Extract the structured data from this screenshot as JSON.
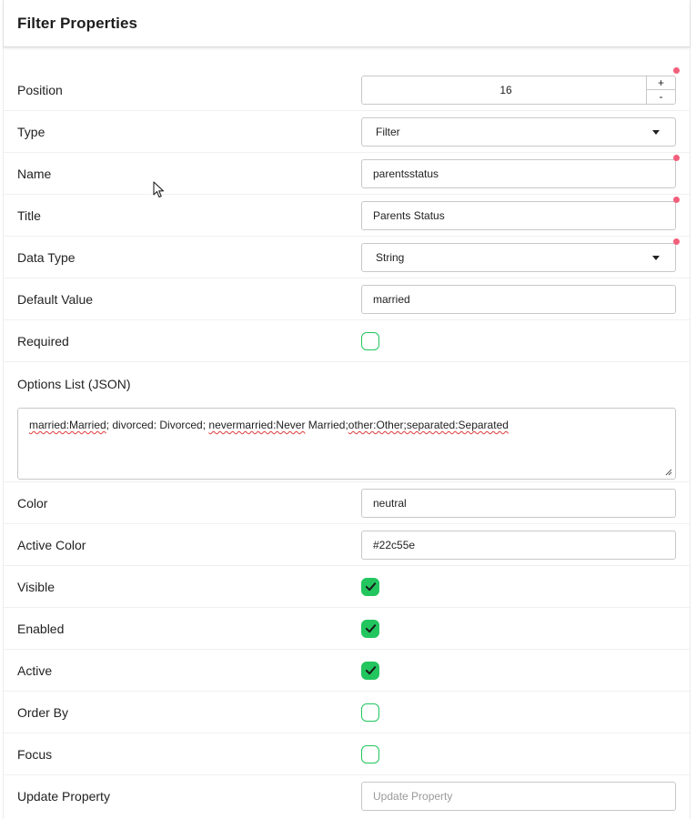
{
  "header": {
    "title": "Filter Properties"
  },
  "fields": {
    "position": {
      "label": "Position",
      "value": "16",
      "plus": "+",
      "minus": "-"
    },
    "type": {
      "label": "Type",
      "value": "Filter"
    },
    "name": {
      "label": "Name",
      "value": "parentsstatus"
    },
    "title": {
      "label": "Title",
      "value": "Parents Status"
    },
    "data_type": {
      "label": "Data Type",
      "value": "String"
    },
    "default_value": {
      "label": "Default Value",
      "value": "married"
    },
    "required": {
      "label": "Required",
      "checked": false
    },
    "options_list": {
      "label": "Options List (JSON)",
      "parts": [
        "married:Married",
        "; divorced: Divorced; ",
        "nevermarried:Never",
        " Married;",
        "other:Other;separated:Separated"
      ]
    },
    "color": {
      "label": "Color",
      "value": "neutral"
    },
    "active_color": {
      "label": "Active Color",
      "value": "#22c55e"
    },
    "visible": {
      "label": "Visible",
      "checked": true
    },
    "enabled": {
      "label": "Enabled",
      "checked": true
    },
    "active": {
      "label": "Active",
      "checked": true
    },
    "order_by": {
      "label": "Order By",
      "checked": false
    },
    "focus": {
      "label": "Focus",
      "checked": false
    },
    "update_property": {
      "label": "Update Property",
      "value": "",
      "placeholder": "Update Property"
    }
  },
  "colors": {
    "accent": "#22c55e",
    "required_dot": "#f25f7b"
  }
}
